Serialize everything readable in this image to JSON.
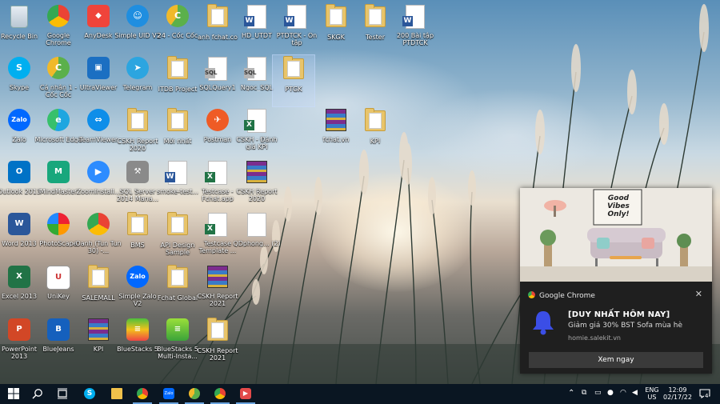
{
  "desktop": {
    "icons": [
      {
        "label": "Recycle Bin"
      },
      {
        "label": "Google Chrome"
      },
      {
        "label": "AnyDesk"
      },
      {
        "label": "Simple UID V2"
      },
      {
        "label": "24 - Cốc Cốc"
      },
      {
        "label": "anh fchat.co"
      },
      {
        "label": "HD_UTDT"
      },
      {
        "label": "PTDTCK - On tập"
      },
      {
        "label": "SKGK"
      },
      {
        "label": "Tester"
      },
      {
        "label": "200 Bài tập PTDTCK"
      },
      {
        "label": "Skype"
      },
      {
        "label": "Cá nhân 1 - Cốc Cốc"
      },
      {
        "label": "UltraViewer"
      },
      {
        "label": "Telegram"
      },
      {
        "label": "ITDB Project"
      },
      {
        "label": "SQLQuery1"
      },
      {
        "label": "Ngoc_SQL"
      },
      {
        "label": "PTGK"
      },
      {
        "label": "Zalo"
      },
      {
        "label": "Microsoft Edge"
      },
      {
        "label": "TeamViewer"
      },
      {
        "label": "CSKH Report 2020"
      },
      {
        "label": "Mới nhất"
      },
      {
        "label": "Postman"
      },
      {
        "label": "CSKH - Đánh giá KPI"
      },
      {
        "label": "fchat.vn"
      },
      {
        "label": "KPI"
      },
      {
        "label": "Outlook 2013"
      },
      {
        "label": "MindMaster"
      },
      {
        "label": "ZoomInstall..."
      },
      {
        "label": "SQL Server 2014 Mana..."
      },
      {
        "label": "smoke-test..."
      },
      {
        "label": "Testcase - Fchat.app"
      },
      {
        "label": "CSKH Report 2020"
      },
      {
        "label": "Word 2013"
      },
      {
        "label": "PhotoScape"
      },
      {
        "label": "Oanh (Tun Tun 30) -..."
      },
      {
        "label": "BMS"
      },
      {
        "label": "API Design Sample"
      },
      {
        "label": "Testcase Template ..."
      },
      {
        "label": "QDphong... (2)"
      },
      {
        "label": "Excel 2013"
      },
      {
        "label": "UniKey"
      },
      {
        "label": "SALEMALL"
      },
      {
        "label": "Simple Zalo V2"
      },
      {
        "label": "Fchat Global"
      },
      {
        "label": "CSKH Report 2021"
      },
      {
        "label": "PowerPoint 2013"
      },
      {
        "label": "BlueJeans"
      },
      {
        "label": "KPI"
      },
      {
        "label": "BlueStacks 5"
      },
      {
        "label": "BlueStacks 5 Multi-Insta..."
      },
      {
        "label": "CSKH Report 2021"
      }
    ]
  },
  "notification": {
    "app_name": "Google Chrome",
    "close_glyph": "✕",
    "hero_text": "Good Vibes Only!",
    "title": "[DUY NHẤT HÔM NAY]",
    "body": "Giảm giá 30% BST Sofa mùa hè",
    "source": "homie.salekit.vn",
    "action_label": "Xem ngay",
    "accent_color": "#3b4ee6"
  },
  "taskbar": {
    "start_icon": "windows-logo-icon",
    "pinned": [
      "search-icon",
      "task-view-icon",
      "skype-icon",
      "file-explorer-icon",
      "chrome-icon",
      "zalo-icon",
      "coccoc-icon",
      "chrome-profile-icon",
      "zoom-icon"
    ],
    "tray": {
      "language": "ENG",
      "region": "US",
      "time": "12:09",
      "date": "02/17/22",
      "notification_count": "4"
    }
  }
}
